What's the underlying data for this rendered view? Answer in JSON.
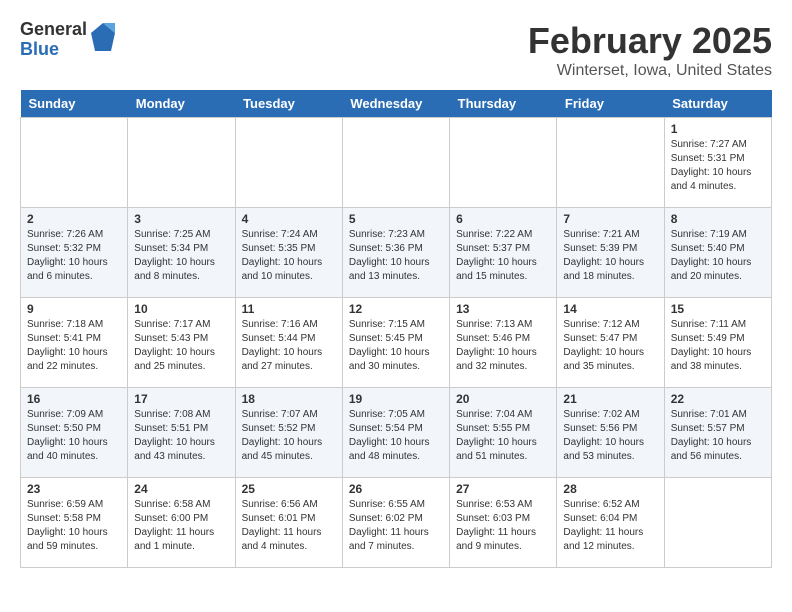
{
  "header": {
    "logo_general": "General",
    "logo_blue": "Blue",
    "title": "February 2025",
    "subtitle": "Winterset, Iowa, United States"
  },
  "weekdays": [
    "Sunday",
    "Monday",
    "Tuesday",
    "Wednesday",
    "Thursday",
    "Friday",
    "Saturday"
  ],
  "weeks": [
    [
      {
        "day": "",
        "info": ""
      },
      {
        "day": "",
        "info": ""
      },
      {
        "day": "",
        "info": ""
      },
      {
        "day": "",
        "info": ""
      },
      {
        "day": "",
        "info": ""
      },
      {
        "day": "",
        "info": ""
      },
      {
        "day": "1",
        "info": "Sunrise: 7:27 AM\nSunset: 5:31 PM\nDaylight: 10 hours\nand 4 minutes."
      }
    ],
    [
      {
        "day": "2",
        "info": "Sunrise: 7:26 AM\nSunset: 5:32 PM\nDaylight: 10 hours\nand 6 minutes."
      },
      {
        "day": "3",
        "info": "Sunrise: 7:25 AM\nSunset: 5:34 PM\nDaylight: 10 hours\nand 8 minutes."
      },
      {
        "day": "4",
        "info": "Sunrise: 7:24 AM\nSunset: 5:35 PM\nDaylight: 10 hours\nand 10 minutes."
      },
      {
        "day": "5",
        "info": "Sunrise: 7:23 AM\nSunset: 5:36 PM\nDaylight: 10 hours\nand 13 minutes."
      },
      {
        "day": "6",
        "info": "Sunrise: 7:22 AM\nSunset: 5:37 PM\nDaylight: 10 hours\nand 15 minutes."
      },
      {
        "day": "7",
        "info": "Sunrise: 7:21 AM\nSunset: 5:39 PM\nDaylight: 10 hours\nand 18 minutes."
      },
      {
        "day": "8",
        "info": "Sunrise: 7:19 AM\nSunset: 5:40 PM\nDaylight: 10 hours\nand 20 minutes."
      }
    ],
    [
      {
        "day": "9",
        "info": "Sunrise: 7:18 AM\nSunset: 5:41 PM\nDaylight: 10 hours\nand 22 minutes."
      },
      {
        "day": "10",
        "info": "Sunrise: 7:17 AM\nSunset: 5:43 PM\nDaylight: 10 hours\nand 25 minutes."
      },
      {
        "day": "11",
        "info": "Sunrise: 7:16 AM\nSunset: 5:44 PM\nDaylight: 10 hours\nand 27 minutes."
      },
      {
        "day": "12",
        "info": "Sunrise: 7:15 AM\nSunset: 5:45 PM\nDaylight: 10 hours\nand 30 minutes."
      },
      {
        "day": "13",
        "info": "Sunrise: 7:13 AM\nSunset: 5:46 PM\nDaylight: 10 hours\nand 32 minutes."
      },
      {
        "day": "14",
        "info": "Sunrise: 7:12 AM\nSunset: 5:47 PM\nDaylight: 10 hours\nand 35 minutes."
      },
      {
        "day": "15",
        "info": "Sunrise: 7:11 AM\nSunset: 5:49 PM\nDaylight: 10 hours\nand 38 minutes."
      }
    ],
    [
      {
        "day": "16",
        "info": "Sunrise: 7:09 AM\nSunset: 5:50 PM\nDaylight: 10 hours\nand 40 minutes."
      },
      {
        "day": "17",
        "info": "Sunrise: 7:08 AM\nSunset: 5:51 PM\nDaylight: 10 hours\nand 43 minutes."
      },
      {
        "day": "18",
        "info": "Sunrise: 7:07 AM\nSunset: 5:52 PM\nDaylight: 10 hours\nand 45 minutes."
      },
      {
        "day": "19",
        "info": "Sunrise: 7:05 AM\nSunset: 5:54 PM\nDaylight: 10 hours\nand 48 minutes."
      },
      {
        "day": "20",
        "info": "Sunrise: 7:04 AM\nSunset: 5:55 PM\nDaylight: 10 hours\nand 51 minutes."
      },
      {
        "day": "21",
        "info": "Sunrise: 7:02 AM\nSunset: 5:56 PM\nDaylight: 10 hours\nand 53 minutes."
      },
      {
        "day": "22",
        "info": "Sunrise: 7:01 AM\nSunset: 5:57 PM\nDaylight: 10 hours\nand 56 minutes."
      }
    ],
    [
      {
        "day": "23",
        "info": "Sunrise: 6:59 AM\nSunset: 5:58 PM\nDaylight: 10 hours\nand 59 minutes."
      },
      {
        "day": "24",
        "info": "Sunrise: 6:58 AM\nSunset: 6:00 PM\nDaylight: 11 hours\nand 1 minute."
      },
      {
        "day": "25",
        "info": "Sunrise: 6:56 AM\nSunset: 6:01 PM\nDaylight: 11 hours\nand 4 minutes."
      },
      {
        "day": "26",
        "info": "Sunrise: 6:55 AM\nSunset: 6:02 PM\nDaylight: 11 hours\nand 7 minutes."
      },
      {
        "day": "27",
        "info": "Sunrise: 6:53 AM\nSunset: 6:03 PM\nDaylight: 11 hours\nand 9 minutes."
      },
      {
        "day": "28",
        "info": "Sunrise: 6:52 AM\nSunset: 6:04 PM\nDaylight: 11 hours\nand 12 minutes."
      },
      {
        "day": "",
        "info": ""
      }
    ]
  ]
}
